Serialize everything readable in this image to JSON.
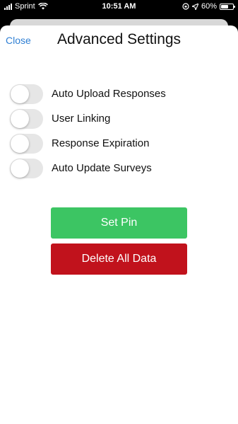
{
  "status_bar": {
    "carrier": "Sprint",
    "time": "10:51 AM",
    "battery_percent": "60%",
    "battery_level": 0.6
  },
  "header": {
    "close_label": "Close",
    "title": "Advanced Settings"
  },
  "settings": [
    {
      "label": "Auto Upload Responses",
      "enabled": false
    },
    {
      "label": "User Linking",
      "enabled": false
    },
    {
      "label": "Response Expiration",
      "enabled": false
    },
    {
      "label": "Auto Update Surveys",
      "enabled": false
    }
  ],
  "buttons": {
    "set_pin_label": "Set Pin",
    "delete_all_label": "Delete All Data"
  },
  "colors": {
    "link": "#2f7fd3",
    "toggle_off": "#e6e6e6",
    "set_pin": "#3cc563",
    "delete": "#c1121c"
  }
}
